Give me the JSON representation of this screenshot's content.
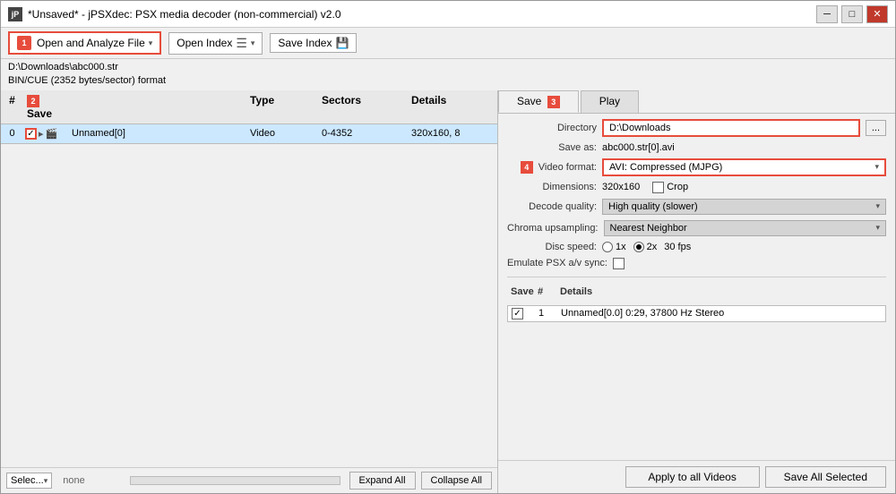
{
  "window": {
    "title": "*Unsaved* - jPSXdec: PSX media decoder (non-commercial) v2.0"
  },
  "toolbar": {
    "open_btn_label": "Open and Analyze File",
    "open_index_label": "Open Index",
    "save_index_label": "Save Index"
  },
  "file_info": {
    "line1": "D:\\Downloads\\abc000.str",
    "line2": "BIN/CUE (2352 bytes/sector) format"
  },
  "table": {
    "headers": [
      "#",
      "Save",
      "Type",
      "Sectors",
      "Details"
    ],
    "rows": [
      {
        "num": "0",
        "checked": true,
        "name": "Unnamed[0]",
        "type": "Video",
        "sectors": "0-4352",
        "details": "320x160, 8"
      }
    ]
  },
  "bottom_bar": {
    "select_label": "Selec...",
    "none_label": "none",
    "expand_label": "Expand All",
    "collapse_label": "Collapse All"
  },
  "right_panel": {
    "tabs": [
      "Save",
      "Play"
    ],
    "active_tab": "Save",
    "directory_label": "Directory",
    "directory_value": "D:\\Downloads",
    "save_as_label": "Save as:",
    "save_as_value": "abc000.str[0].avi",
    "video_format_label": "Video format:",
    "video_format_value": "AVI: Compressed (MJPG)",
    "dimensions_label": "Dimensions:",
    "dimensions_value": "320x160",
    "crop_label": "Crop",
    "decode_quality_label": "Decode quality:",
    "decode_quality_value": "High quality (slower)",
    "chroma_label": "Chroma upsampling:",
    "chroma_value": "Nearest Neighbor",
    "disc_speed_label": "Disc speed:",
    "disc_1x": "1x",
    "disc_2x": "2x",
    "disc_fps": "30 fps",
    "emulate_label": "Emulate PSX a/v sync:",
    "audio_headers": [
      "Save",
      "#",
      "Details"
    ],
    "audio_rows": [
      {
        "checked": true,
        "num": "1",
        "details": "Unnamed[0.0]  0:29, 37800 Hz Stereo"
      }
    ],
    "apply_btn": "Apply to all Videos",
    "save_btn": "Save All Selected"
  },
  "badges": {
    "b1": "1",
    "b2": "2",
    "b3": "3",
    "b4": "4"
  }
}
